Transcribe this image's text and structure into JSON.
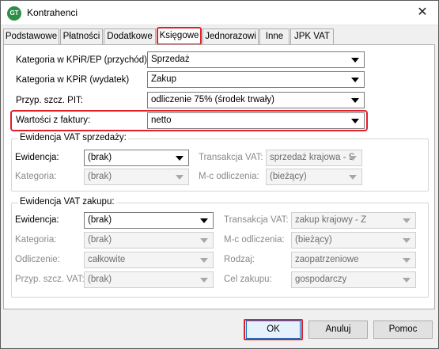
{
  "window": {
    "title": "Kontrahenci",
    "app_icon_text": "GT",
    "close_glyph": "✕"
  },
  "tabs": [
    {
      "label": "Podstawowe"
    },
    {
      "label": "Płatności"
    },
    {
      "label": "Dodatkowe"
    },
    {
      "label": "Księgowe",
      "active": true
    },
    {
      "label": "Jednorazowi"
    },
    {
      "label": "Inne"
    },
    {
      "label": "JPK VAT"
    }
  ],
  "top_fields": {
    "kpir_przychod": {
      "label": "Kategoria w KPiR/EP (przychód):",
      "value": "Sprzedaż"
    },
    "kpir_wydatek": {
      "label": "Kategoria w KPiR (wydatek)",
      "value": "Zakup"
    },
    "pit": {
      "label": "Przyp. szcz. PIT:",
      "value": "odliczenie 75% (środek trwały)"
    },
    "wartosci": {
      "label": "Wartości z faktury:",
      "value": "netto"
    }
  },
  "vat_sales": {
    "title": "Ewidencja VAT sprzedaży:",
    "ewidencja": {
      "label": "Ewidencja:",
      "value": "(brak)"
    },
    "transakcja": {
      "label": "Transakcja VAT:",
      "value": "sprzedaż krajowa - S"
    },
    "kategoria": {
      "label": "Kategoria:",
      "value": "(brak)"
    },
    "mc": {
      "label": "M-c odliczenia:",
      "value": "(bieżący)"
    }
  },
  "vat_purchase": {
    "title": "Ewidencja VAT zakupu:",
    "ewidencja": {
      "label": "Ewidencja:",
      "value": "(brak)"
    },
    "transakcja": {
      "label": "Transakcja VAT:",
      "value": "zakup krajowy - Z"
    },
    "kategoria": {
      "label": "Kategoria:",
      "value": "(brak)"
    },
    "mc": {
      "label": "M-c odliczenia:",
      "value": "(bieżący)"
    },
    "odliczenie": {
      "label": "Odliczenie:",
      "value": "całkowite"
    },
    "rodzaj": {
      "label": "Rodzaj:",
      "value": "zaopatrzeniowe"
    },
    "pit": {
      "label": "Przyp. szcz. VAT:",
      "value": "(brak)"
    },
    "cel": {
      "label": "Cel zakupu:",
      "value": "gospodarczy"
    }
  },
  "buttons": {
    "ok": "OK",
    "cancel": "Anuluj",
    "help": "Pomoc"
  },
  "colors": {
    "highlight": "#e0202a",
    "ok_border": "#0078d7"
  }
}
